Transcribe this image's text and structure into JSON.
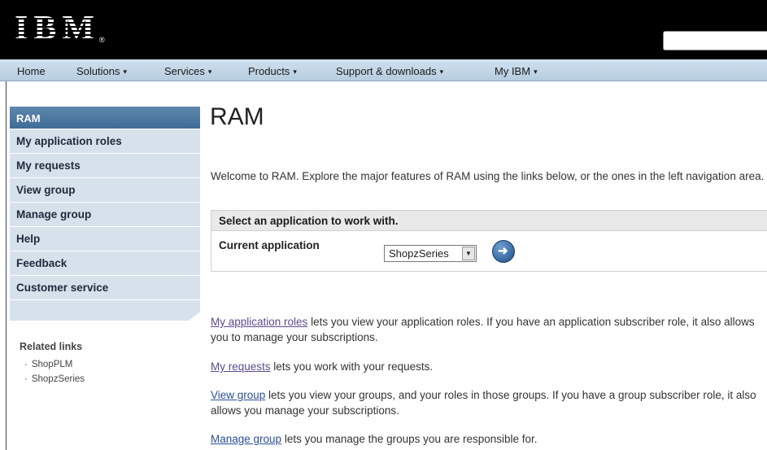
{
  "masthead": {
    "logo_text": "IBM",
    "logo_mark": "®"
  },
  "nav": {
    "items": [
      {
        "label": "Home",
        "caret": ""
      },
      {
        "label": "Solutions",
        "caret": "▾"
      },
      {
        "label": "Services",
        "caret": "▾"
      },
      {
        "label": "Products",
        "caret": "▾"
      },
      {
        "label": "Support & downloads",
        "caret": "▾"
      },
      {
        "label": "My IBM",
        "caret": "▾"
      }
    ]
  },
  "sidebar": {
    "heading": "RAM",
    "items": [
      "My application roles",
      "My requests",
      "View group",
      "Manage group",
      "Help",
      "Feedback",
      "Customer service"
    ]
  },
  "related": {
    "title": "Related links",
    "links": [
      "ShopPLM",
      "ShopzSeries"
    ]
  },
  "main": {
    "title": "RAM",
    "welcome": "Welcome to RAM. Explore the major features of RAM using the links below, or the ones in the left navigation area.",
    "panel": {
      "heading": "Select an application to work with.",
      "current_label": "Current application",
      "selected_app": "ShopzSeries"
    },
    "paragraphs": [
      {
        "link": "My application roles",
        "text": " lets you view your application roles. If you have an application subscriber role, it also allows you to manage your subscriptions."
      },
      {
        "link": "My requests",
        "text": " lets you work with your requests."
      },
      {
        "link": "View group",
        "text": " lets you view your groups, and your roles in those groups. If you have a group subscriber role, it also allows you manage your subscriptions."
      },
      {
        "link": "Manage group",
        "text": " lets you manage the groups you are responsible for."
      }
    ]
  },
  "colors": {
    "masthead": "#000000",
    "nav_bg": "#c4d7e8",
    "sidebar_head": "#4a76a0",
    "sidebar_item": "#d7e1ec",
    "link_visited": "#5c4a8e",
    "link": "#2a4f9a"
  }
}
